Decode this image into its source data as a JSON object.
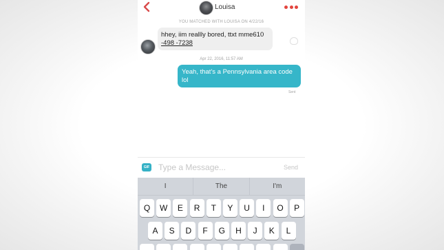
{
  "header": {
    "back_icon": "chevron-left-icon",
    "name": "Louisa",
    "more_icon": "three-dots-icon",
    "accent": "#e3453e"
  },
  "conversation": {
    "match_notice": "YOU MATCHED WITH LOUISA ON 4/22/16",
    "incoming": {
      "line1": "hhey, iim reallly bored, ttxt mme610",
      "line2": "-498 -7238"
    },
    "timestamp": "Apr 22, 2016, 11:57 AM",
    "outgoing": {
      "line1": "Yeah, that's a Pennsylvania area code",
      "line2": "lol",
      "color": "#36b6c9"
    },
    "status": "Sent"
  },
  "composer": {
    "gif_label": "GIF",
    "placeholder": "Type a Message...",
    "send_label": "Send"
  },
  "keyboard": {
    "suggestions": [
      "I",
      "The",
      "I'm"
    ],
    "row1": [
      "Q",
      "W",
      "E",
      "R",
      "T",
      "Y",
      "U",
      "I",
      "O",
      "P"
    ],
    "row2": [
      "A",
      "S",
      "D",
      "F",
      "G",
      "H",
      "J",
      "K",
      "L"
    ],
    "row3": [
      "",
      "",
      "",
      "",
      "",
      "",
      "",
      "",
      "",
      ""
    ]
  }
}
